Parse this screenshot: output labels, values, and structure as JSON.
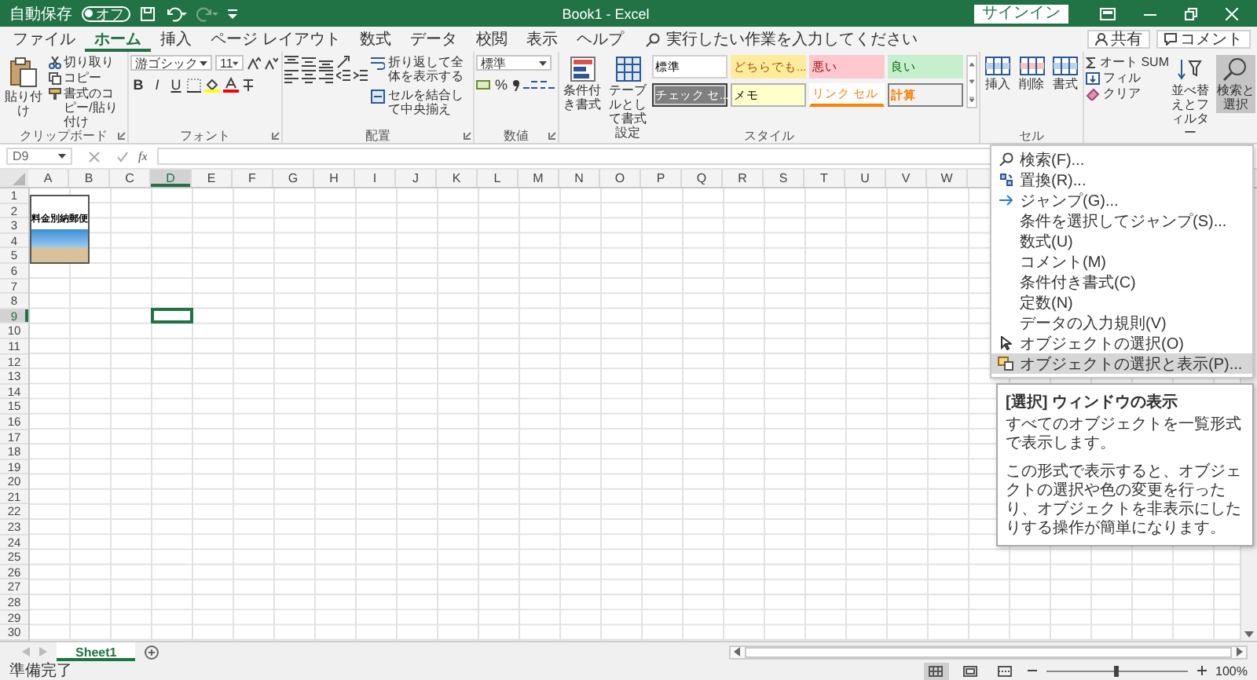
{
  "title_bar": {
    "autosave_label": "自動保存",
    "autosave": {
      "label": "オフ",
      "on": false
    },
    "title": "Book1 - Excel",
    "signin_button": "サインイン"
  },
  "tabs": [
    {
      "label": "ファイル",
      "selected": false
    },
    {
      "label": "ホーム",
      "selected": true
    },
    {
      "label": "挿入",
      "selected": false
    },
    {
      "label": "ページ レイアウト",
      "selected": false
    },
    {
      "label": "数式",
      "selected": false
    },
    {
      "label": "データ",
      "selected": false
    },
    {
      "label": "校閲",
      "selected": false
    },
    {
      "label": "表示",
      "selected": false
    },
    {
      "label": "ヘルプ",
      "selected": false
    }
  ],
  "tell_me": {
    "placeholder": "実行したい作業を入力してください"
  },
  "share_button": "共有",
  "comments_button": "コメント",
  "clipboard": {
    "label": "クリップボード",
    "paste": "貼り付け",
    "cut": "切り取り",
    "copy": "コピー",
    "format_painter": "書式のコピー/貼り付け"
  },
  "font": {
    "label": "フォント",
    "font_name": "游ゴシック",
    "font_size": "11",
    "style_buttons": [
      "B",
      "I",
      "U"
    ]
  },
  "alignment": {
    "label": "配置",
    "wrap_text": "折り返して全体を表示する",
    "merge_center": "セルを結合して中央揃え"
  },
  "number": {
    "label": "数値",
    "format": "標準",
    "percent": "%"
  },
  "styles": {
    "label": "スタイル",
    "conditional_formatting": "条件付き書式",
    "format_as_table": "テーブルとして書式設定",
    "gallery": [
      {
        "label": "標準",
        "kind": "normal"
      },
      {
        "label": "どちらでも...",
        "kind": "neutral"
      },
      {
        "label": "悪い",
        "kind": "bad"
      },
      {
        "label": "良い",
        "kind": "good"
      },
      {
        "label": "チェック セ...",
        "kind": "check"
      },
      {
        "label": "メモ",
        "kind": "note"
      },
      {
        "label": "リンク セル",
        "kind": "linked"
      },
      {
        "label": "計算",
        "kind": "calc"
      }
    ]
  },
  "cells": {
    "label": "セル",
    "buttons": [
      "挿入",
      "削除",
      "書式"
    ]
  },
  "editing": {
    "autosum": "オート SUM",
    "fill": "フィル",
    "clear": "クリア",
    "sort_filter": "並べ替えとフィルター",
    "find_select": {
      "label": "検索と選択",
      "pressed": true
    }
  },
  "formula_bar": {
    "name_box": "D9",
    "function_label": "fx"
  },
  "sheet": {
    "columns": [
      {
        "label": "A",
        "selected": false
      },
      {
        "label": "B",
        "selected": false
      },
      {
        "label": "C",
        "selected": false
      },
      {
        "label": "D",
        "selected": true
      },
      {
        "label": "E",
        "selected": false
      },
      {
        "label": "F",
        "selected": false
      },
      {
        "label": "G",
        "selected": false
      },
      {
        "label": "H",
        "selected": false
      },
      {
        "label": "I",
        "selected": false
      },
      {
        "label": "J",
        "selected": false
      },
      {
        "label": "K",
        "selected": false
      },
      {
        "label": "L",
        "selected": false
      },
      {
        "label": "M",
        "selected": false
      },
      {
        "label": "N",
        "selected": false
      },
      {
        "label": "O",
        "selected": false
      },
      {
        "label": "P",
        "selected": false
      },
      {
        "label": "Q",
        "selected": false
      },
      {
        "label": "R",
        "selected": false
      },
      {
        "label": "S",
        "selected": false
      },
      {
        "label": "T",
        "selected": false
      },
      {
        "label": "U",
        "selected": false
      },
      {
        "label": "V",
        "selected": false
      },
      {
        "label": "W",
        "selected": false
      }
    ],
    "rows": [
      {
        "label": "1",
        "selected": false
      },
      {
        "label": "2",
        "selected": false
      },
      {
        "label": "3",
        "selected": false
      },
      {
        "label": "4",
        "selected": false
      },
      {
        "label": "5",
        "selected": false
      },
      {
        "label": "6",
        "selected": false
      },
      {
        "label": "7",
        "selected": false
      },
      {
        "label": "8",
        "selected": false
      },
      {
        "label": "9",
        "selected": true
      },
      {
        "label": "10",
        "selected": false
      },
      {
        "label": "11",
        "selected": false
      },
      {
        "label": "12",
        "selected": false
      },
      {
        "label": "13",
        "selected": false
      },
      {
        "label": "14",
        "selected": false
      },
      {
        "label": "15",
        "selected": false
      },
      {
        "label": "16",
        "selected": false
      },
      {
        "label": "17",
        "selected": false
      },
      {
        "label": "18",
        "selected": false
      },
      {
        "label": "19",
        "selected": false
      },
      {
        "label": "20",
        "selected": false
      },
      {
        "label": "21",
        "selected": false
      },
      {
        "label": "22",
        "selected": false
      },
      {
        "label": "23",
        "selected": false
      },
      {
        "label": "24",
        "selected": false
      },
      {
        "label": "25",
        "selected": false
      },
      {
        "label": "26",
        "selected": false
      },
      {
        "label": "27",
        "selected": false
      },
      {
        "label": "28",
        "selected": false
      },
      {
        "label": "29",
        "selected": false
      },
      {
        "label": "30",
        "selected": false
      }
    ],
    "picture": {
      "caption": "料金別納郵便"
    }
  },
  "sheet_tabs": [
    {
      "label": "Sheet1",
      "selected": true
    }
  ],
  "status_bar": {
    "text": "準備完了",
    "views": [
      {
        "kind": "normal",
        "selected": true
      },
      {
        "kind": "page_layout",
        "selected": false
      },
      {
        "kind": "page_break",
        "selected": false
      }
    ],
    "zoom": {
      "level": 0.5,
      "reading": "100%"
    }
  },
  "find_menu": {
    "items": [
      {
        "label": "検索(F)...",
        "kind": "search",
        "selected": false
      },
      {
        "label": "置換(R)...",
        "kind": "replace",
        "selected": false
      },
      {
        "label": "ジャンプ(G)...",
        "kind": "goto",
        "selected": false
      },
      {
        "label": "条件を選択してジャンプ(S)...",
        "kind": "plain",
        "selected": false
      },
      {
        "label": "数式(U)",
        "kind": "plain",
        "selected": false
      },
      {
        "label": "コメント(M)",
        "kind": "plain",
        "selected": false
      },
      {
        "label": "条件付き書式(C)",
        "kind": "plain",
        "selected": false
      },
      {
        "label": "定数(N)",
        "kind": "plain",
        "selected": false
      },
      {
        "label": "データの入力規則(V)",
        "kind": "plain",
        "selected": false
      },
      {
        "label": "オブジェクトの選択(O)",
        "kind": "pointer",
        "selected": false
      },
      {
        "label": "オブジェクトの選択と表示(P)...",
        "kind": "pane",
        "selected": true
      }
    ]
  },
  "tooltip": {
    "title": "[選択] ウィンドウの表示",
    "paragraphs": [
      "すべてのオブジェクトを一覧形式で表示します。",
      "この形式で表示すると、オブジェクトの選択や色の変更を行ったり、オブジェクトを非表示にしたりする操作が簡単になります。"
    ]
  }
}
